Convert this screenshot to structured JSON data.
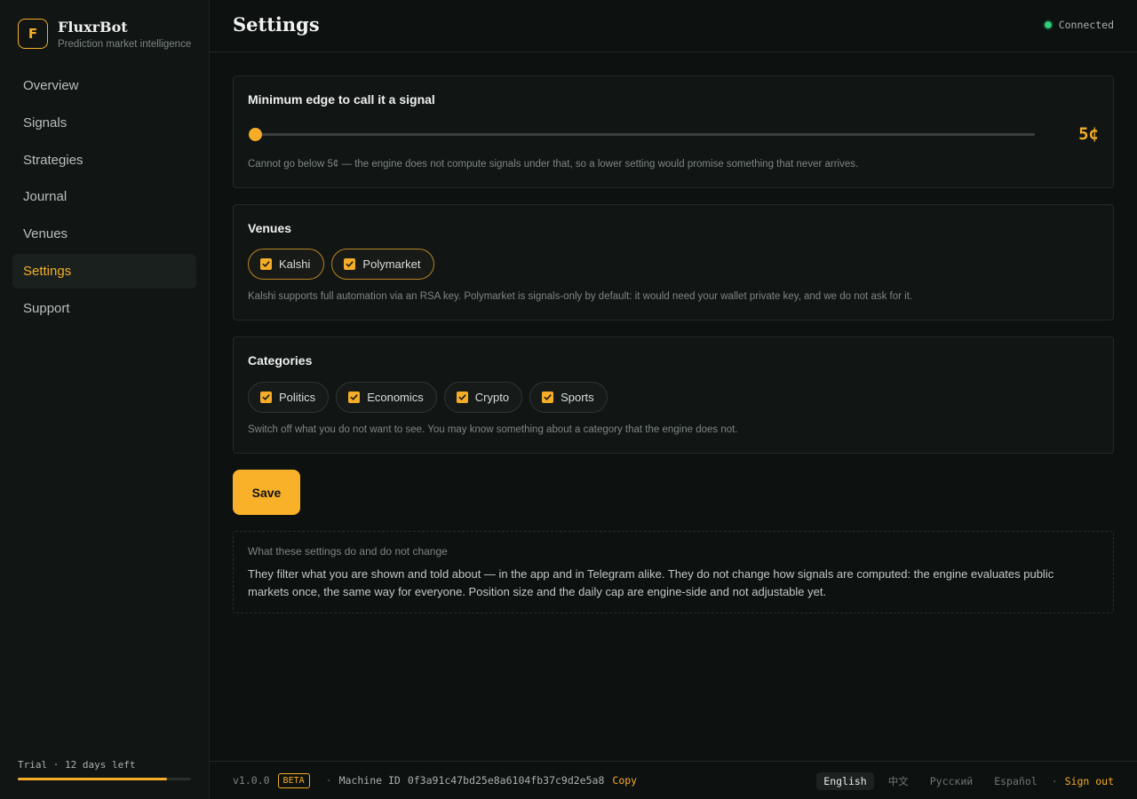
{
  "brand": {
    "logo_letter": "F",
    "name": "FluxrBot",
    "subtitle": "Prediction market intelligence"
  },
  "nav": {
    "items": [
      {
        "label": "Overview"
      },
      {
        "label": "Signals"
      },
      {
        "label": "Strategies"
      },
      {
        "label": "Journal"
      },
      {
        "label": "Venues"
      },
      {
        "label": "Settings",
        "active": true
      },
      {
        "label": "Support"
      }
    ]
  },
  "trial": {
    "label": "Trial · 12 days left",
    "progress_fraction": 0.86
  },
  "header": {
    "title": "Settings",
    "status": "Connected",
    "status_color": "#2fd17a"
  },
  "edge": {
    "title": "Minimum edge to call it a signal",
    "value": 5,
    "value_label": "5¢",
    "slider_position_fraction": 0.0,
    "help": "Cannot go below 5¢ — the engine does not compute signals under that, so a lower setting would promise something that never arrives."
  },
  "venues": {
    "title": "Venues",
    "options": [
      {
        "label": "Kalshi",
        "checked": true
      },
      {
        "label": "Polymarket",
        "checked": true
      }
    ],
    "help": "Kalshi supports full automation via an RSA key. Polymarket is signals-only by default: it would need your wallet private key, and we do not ask for it."
  },
  "categories": {
    "title": "Categories",
    "options": [
      {
        "label": "Politics",
        "checked": true
      },
      {
        "label": "Economics",
        "checked": true
      },
      {
        "label": "Crypto",
        "checked": true
      },
      {
        "label": "Sports",
        "checked": true
      }
    ],
    "help": "Switch off what you do not want to see. You may know something about a category that the engine does not."
  },
  "save_label": "Save",
  "note": {
    "title": "What these settings do and do not change",
    "body": "They filter what you are shown and told about — in the app and in Telegram alike. They do not change how signals are computed: the engine evaluates public markets once, the same way for everyone. Position size and the daily cap are engine-side and not adjustable yet."
  },
  "footer": {
    "version": "v1.0.0",
    "badge": "BETA",
    "sep": "·",
    "machine_label": "Machine ID",
    "machine_id": "0f3a91c47bd25e8a6104fb37c9d2e5a8",
    "copy_label": "Copy",
    "languages": [
      {
        "label": "English",
        "active": true
      },
      {
        "label": "中文"
      },
      {
        "label": "Русский"
      },
      {
        "label": "Español"
      }
    ],
    "sign_out": "Sign out"
  },
  "colors": {
    "accent": "#f5ad28",
    "background": "#0d1110"
  }
}
